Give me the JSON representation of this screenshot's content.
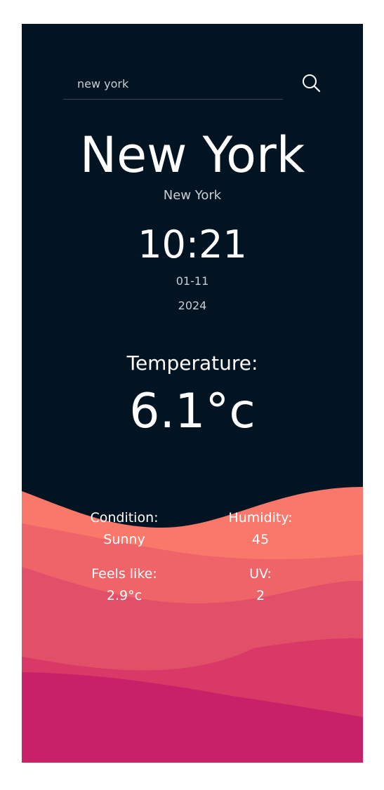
{
  "search": {
    "value": "new york",
    "button_icon": "search-icon"
  },
  "location": {
    "city": "New York",
    "region": "New York"
  },
  "clock": {
    "time": "10:21",
    "date": "01-11",
    "year": "2024"
  },
  "temperature": {
    "label": "Temperature:",
    "value": "6.1°c"
  },
  "details": {
    "condition": {
      "label": "Condition:",
      "value": "Sunny"
    },
    "humidity": {
      "label": "Humidity:",
      "value": "45"
    },
    "feels_like": {
      "label": "Feels like:",
      "value": "2.9°c"
    },
    "uv": {
      "label": "UV:",
      "value": "2"
    }
  },
  "colors": {
    "background": "#021321",
    "wave_1": "#f9786a",
    "wave_2": "#ef6468",
    "wave_3": "#e24f69",
    "wave_4": "#d93967",
    "wave_5": "#c82167",
    "text": "#ffffff",
    "muted_text": "#c9ced3"
  }
}
